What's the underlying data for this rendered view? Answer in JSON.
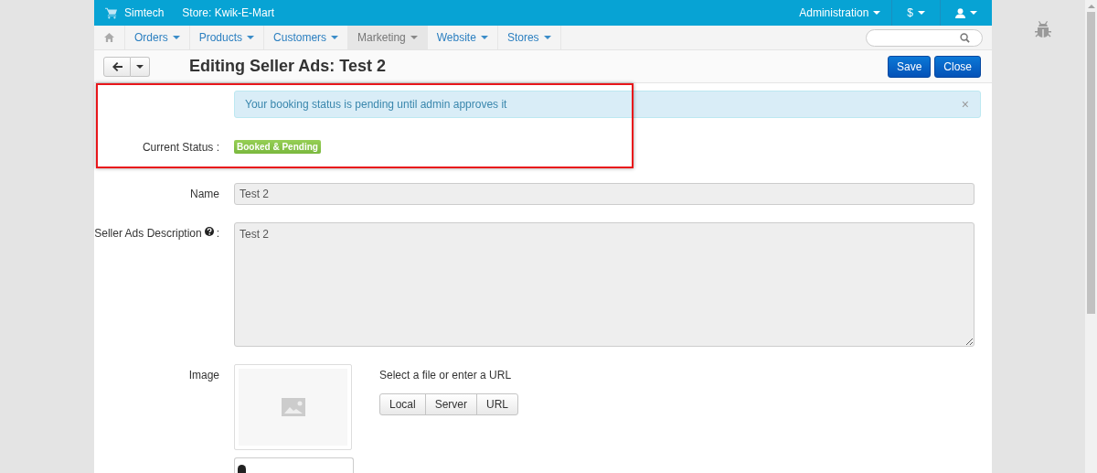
{
  "top_bar": {
    "brand": "Simtech",
    "store": "Store: Kwik-E-Mart",
    "admin_menu": "Administration",
    "currency_menu": "$"
  },
  "nav": {
    "items": [
      {
        "label": "Orders",
        "selected": false
      },
      {
        "label": "Products",
        "selected": false
      },
      {
        "label": "Customers",
        "selected": false
      },
      {
        "label": "Marketing",
        "selected": true
      },
      {
        "label": "Website",
        "selected": false
      },
      {
        "label": "Stores",
        "selected": false
      }
    ]
  },
  "title": "Editing Seller Ads: Test 2",
  "buttons": [
    "Save",
    "Close"
  ],
  "notice": {
    "text": "Your booking status is pending until admin approves it",
    "close": "×"
  },
  "status": {
    "label": "Current Status :",
    "badge": "Booked & Pending"
  },
  "fields": [
    {
      "kind": "input",
      "label": "Name",
      "value": "Test 2",
      "disabled": true
    },
    {
      "kind": "textarea",
      "label": "Seller Ads Description",
      "help": true,
      "suffix": ":",
      "value": "Test 2",
      "disabled": true
    },
    {
      "kind": "image",
      "label": "Image",
      "hint": "Select a file or enter a URL",
      "buttons": [
        "Local",
        "Server",
        "URL"
      ]
    }
  ]
}
